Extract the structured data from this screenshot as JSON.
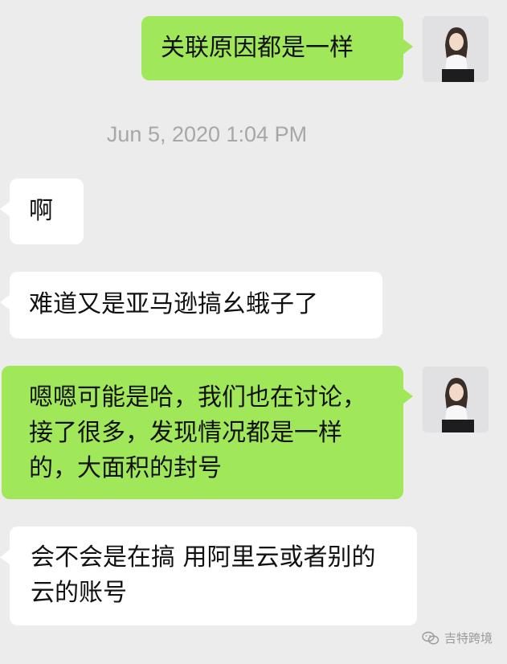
{
  "messages": [
    {
      "text": "关联原因都是一样"
    },
    {
      "text": "啊"
    },
    {
      "text": "难道又是亚马逊搞幺蛾子了"
    },
    {
      "text": "嗯嗯可能是哈，我们也在讨论，接了很多，发现情况都是一样的，大面积的封号"
    },
    {
      "text": "会不会是在搞 用阿里云或者别的云的账号"
    }
  ],
  "timestamp": "Jun 5, 2020 1:04 PM",
  "watermark": {
    "text": "吉特跨境",
    "icon": "wechat-icon"
  },
  "colors": {
    "background": "#ececec",
    "sent_bubble": "#a0e75a",
    "received_bubble": "#ffffff",
    "timestamp": "#a7a7a7"
  }
}
